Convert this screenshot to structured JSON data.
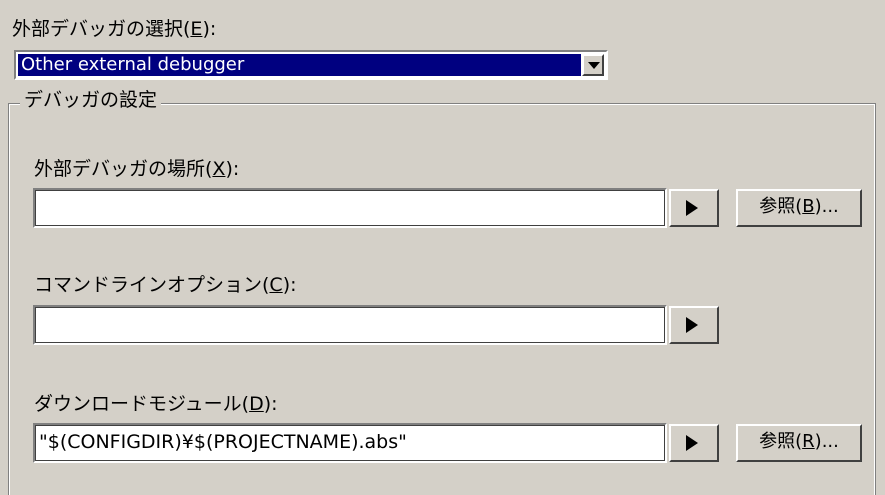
{
  "debugger_select": {
    "label": "外部デバッガの選択(",
    "mnemonic": "E",
    "label_suffix": "):",
    "selected": "Other external debugger"
  },
  "group": {
    "title": "デバッガの設定"
  },
  "location": {
    "label": "外部デバッガの場所(",
    "mnemonic": "X",
    "label_suffix": "):",
    "value": "",
    "browse_label": "参照(",
    "browse_mnemonic": "B",
    "browse_suffix": ")..."
  },
  "options": {
    "label": "コマンドラインオプション(",
    "mnemonic": "C",
    "label_suffix": "):",
    "value": ""
  },
  "download": {
    "label": "ダウンロードモジュール(",
    "mnemonic": "D",
    "label_suffix": "):",
    "value": "\"$(CONFIGDIR)¥$(PROJECTNAME).abs\"",
    "browse_label": "参照(",
    "browse_mnemonic": "R",
    "browse_suffix": ")..."
  },
  "icons": {
    "dropdown": "chevron-down-icon",
    "insert_macro": "play-arrow-icon"
  }
}
